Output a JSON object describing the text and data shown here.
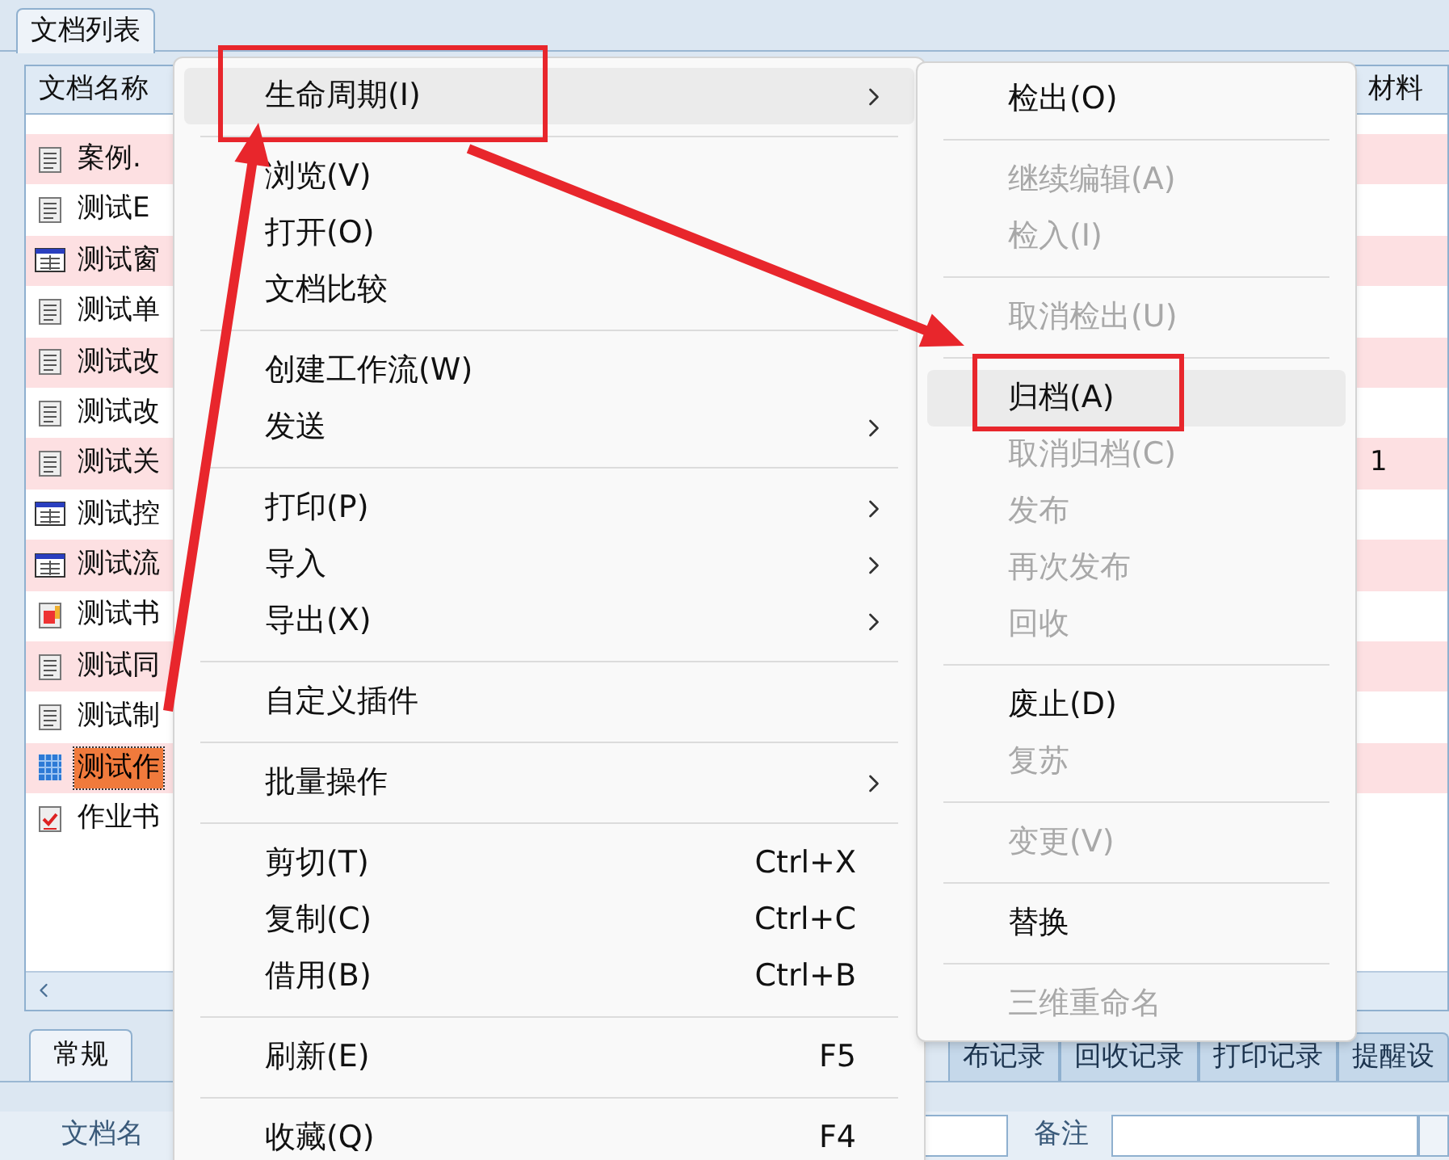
{
  "panel_tab": {
    "label": "文档列表"
  },
  "table": {
    "columns": [
      "文档名称",
      "材料"
    ],
    "rows": [
      {
        "kind": "doc",
        "name": "案例.",
        "selected": false
      },
      {
        "kind": "doc",
        "name": "测试E",
        "selected": false
      },
      {
        "kind": "form",
        "name": "测试窗",
        "selected": false
      },
      {
        "kind": "doc",
        "name": "测试单",
        "selected": false
      },
      {
        "kind": "doc",
        "name": "测试改",
        "selected": false
      },
      {
        "kind": "doc",
        "name": "测试改",
        "selected": false
      },
      {
        "kind": "doc",
        "name": "测试关",
        "material": "1",
        "selected": false
      },
      {
        "kind": "form",
        "name": "测试控",
        "selected": false
      },
      {
        "kind": "form",
        "name": "测试流",
        "selected": false
      },
      {
        "kind": "sheet",
        "name": "测试书",
        "selected": false
      },
      {
        "kind": "doc",
        "name": "测试同",
        "selected": false
      },
      {
        "kind": "doc",
        "name": "测试制",
        "selected": false
      },
      {
        "kind": "grid",
        "name": "测试作",
        "selected": true
      },
      {
        "kind": "check",
        "name": "作业书",
        "selected": false
      }
    ]
  },
  "context_menu": [
    {
      "kind": "item",
      "label": "生命周期(I)",
      "submenu": true,
      "highlighted": true,
      "marked": true
    },
    {
      "kind": "separator"
    },
    {
      "kind": "item",
      "label": "浏览(V)",
      "submenu": false,
      "highlighted": false,
      "marked": false
    },
    {
      "kind": "item",
      "label": "打开(O)",
      "submenu": false,
      "highlighted": false,
      "marked": false
    },
    {
      "kind": "item",
      "label": "文档比较",
      "submenu": false,
      "highlighted": false,
      "marked": false
    },
    {
      "kind": "separator"
    },
    {
      "kind": "item",
      "label": "创建工作流(W)",
      "submenu": false,
      "highlighted": false,
      "marked": false
    },
    {
      "kind": "item",
      "label": "发送",
      "submenu": true,
      "highlighted": false,
      "marked": false
    },
    {
      "kind": "separator"
    },
    {
      "kind": "item",
      "label": "打印(P)",
      "submenu": true,
      "highlighted": false,
      "marked": false
    },
    {
      "kind": "item",
      "label": "导入",
      "submenu": true,
      "highlighted": false,
      "marked": false
    },
    {
      "kind": "item",
      "label": "导出(X)",
      "submenu": true,
      "highlighted": false,
      "marked": false
    },
    {
      "kind": "separator"
    },
    {
      "kind": "item",
      "label": "自定义插件",
      "submenu": false,
      "highlighted": false,
      "marked": false
    },
    {
      "kind": "separator"
    },
    {
      "kind": "item",
      "label": "批量操作",
      "submenu": true,
      "highlighted": false,
      "marked": false
    },
    {
      "kind": "separator"
    },
    {
      "kind": "item",
      "label": "剪切(T)",
      "shortcut": "Ctrl+X",
      "submenu": false,
      "highlighted": false,
      "marked": false
    },
    {
      "kind": "item",
      "label": "复制(C)",
      "shortcut": "Ctrl+C",
      "submenu": false,
      "highlighted": false,
      "marked": false
    },
    {
      "kind": "item",
      "label": "借用(B)",
      "shortcut": "Ctrl+B",
      "submenu": false,
      "highlighted": false,
      "marked": false
    },
    {
      "kind": "separator"
    },
    {
      "kind": "item",
      "label": "刷新(E)",
      "shortcut": "F5",
      "submenu": false,
      "highlighted": false,
      "marked": false
    },
    {
      "kind": "separator"
    },
    {
      "kind": "item",
      "label": "收藏(Q)",
      "shortcut": "F4",
      "submenu": false,
      "highlighted": false,
      "marked": false
    }
  ],
  "submenu": [
    {
      "kind": "item",
      "label": "检出(O)",
      "disabled": false,
      "highlighted": false,
      "marked": false
    },
    {
      "kind": "separator"
    },
    {
      "kind": "item",
      "label": "继续编辑(A)",
      "disabled": true,
      "highlighted": false,
      "marked": false
    },
    {
      "kind": "item",
      "label": "检入(I)",
      "disabled": true,
      "highlighted": false,
      "marked": false
    },
    {
      "kind": "separator"
    },
    {
      "kind": "item",
      "label": "取消检出(U)",
      "disabled": true,
      "highlighted": false,
      "marked": false
    },
    {
      "kind": "separator"
    },
    {
      "kind": "item",
      "label": "归档(A)",
      "disabled": false,
      "highlighted": true,
      "marked": true
    },
    {
      "kind": "item",
      "label": "取消归档(C)",
      "disabled": true,
      "highlighted": false,
      "marked": false
    },
    {
      "kind": "item",
      "label": "发布",
      "disabled": true,
      "highlighted": false,
      "marked": false
    },
    {
      "kind": "item",
      "label": "再次发布",
      "disabled": true,
      "highlighted": false,
      "marked": false
    },
    {
      "kind": "item",
      "label": "回收",
      "disabled": true,
      "highlighted": false,
      "marked": false
    },
    {
      "kind": "separator"
    },
    {
      "kind": "item",
      "label": "废止(D)",
      "disabled": false,
      "highlighted": false,
      "marked": false
    },
    {
      "kind": "item",
      "label": "复苏",
      "disabled": true,
      "highlighted": false,
      "marked": false
    },
    {
      "kind": "separator"
    },
    {
      "kind": "item",
      "label": "变更(V)",
      "disabled": true,
      "highlighted": false,
      "marked": false
    },
    {
      "kind": "separator"
    },
    {
      "kind": "item",
      "label": "替换",
      "disabled": false,
      "highlighted": false,
      "marked": false
    },
    {
      "kind": "separator"
    },
    {
      "kind": "item",
      "label": "三维重命名",
      "disabled": true,
      "highlighted": false,
      "marked": false
    }
  ],
  "bottom_tabs_left": [
    {
      "label": "常规",
      "selected": true
    }
  ],
  "bottom_tabs_right": [
    {
      "label": "布记录",
      "selected": false
    },
    {
      "label": "回收记录",
      "selected": false
    },
    {
      "label": "打印记录",
      "selected": false
    },
    {
      "label": "提醒设",
      "selected": false
    }
  ],
  "form": {
    "name_label": "文档名",
    "remark_label": "备注"
  }
}
